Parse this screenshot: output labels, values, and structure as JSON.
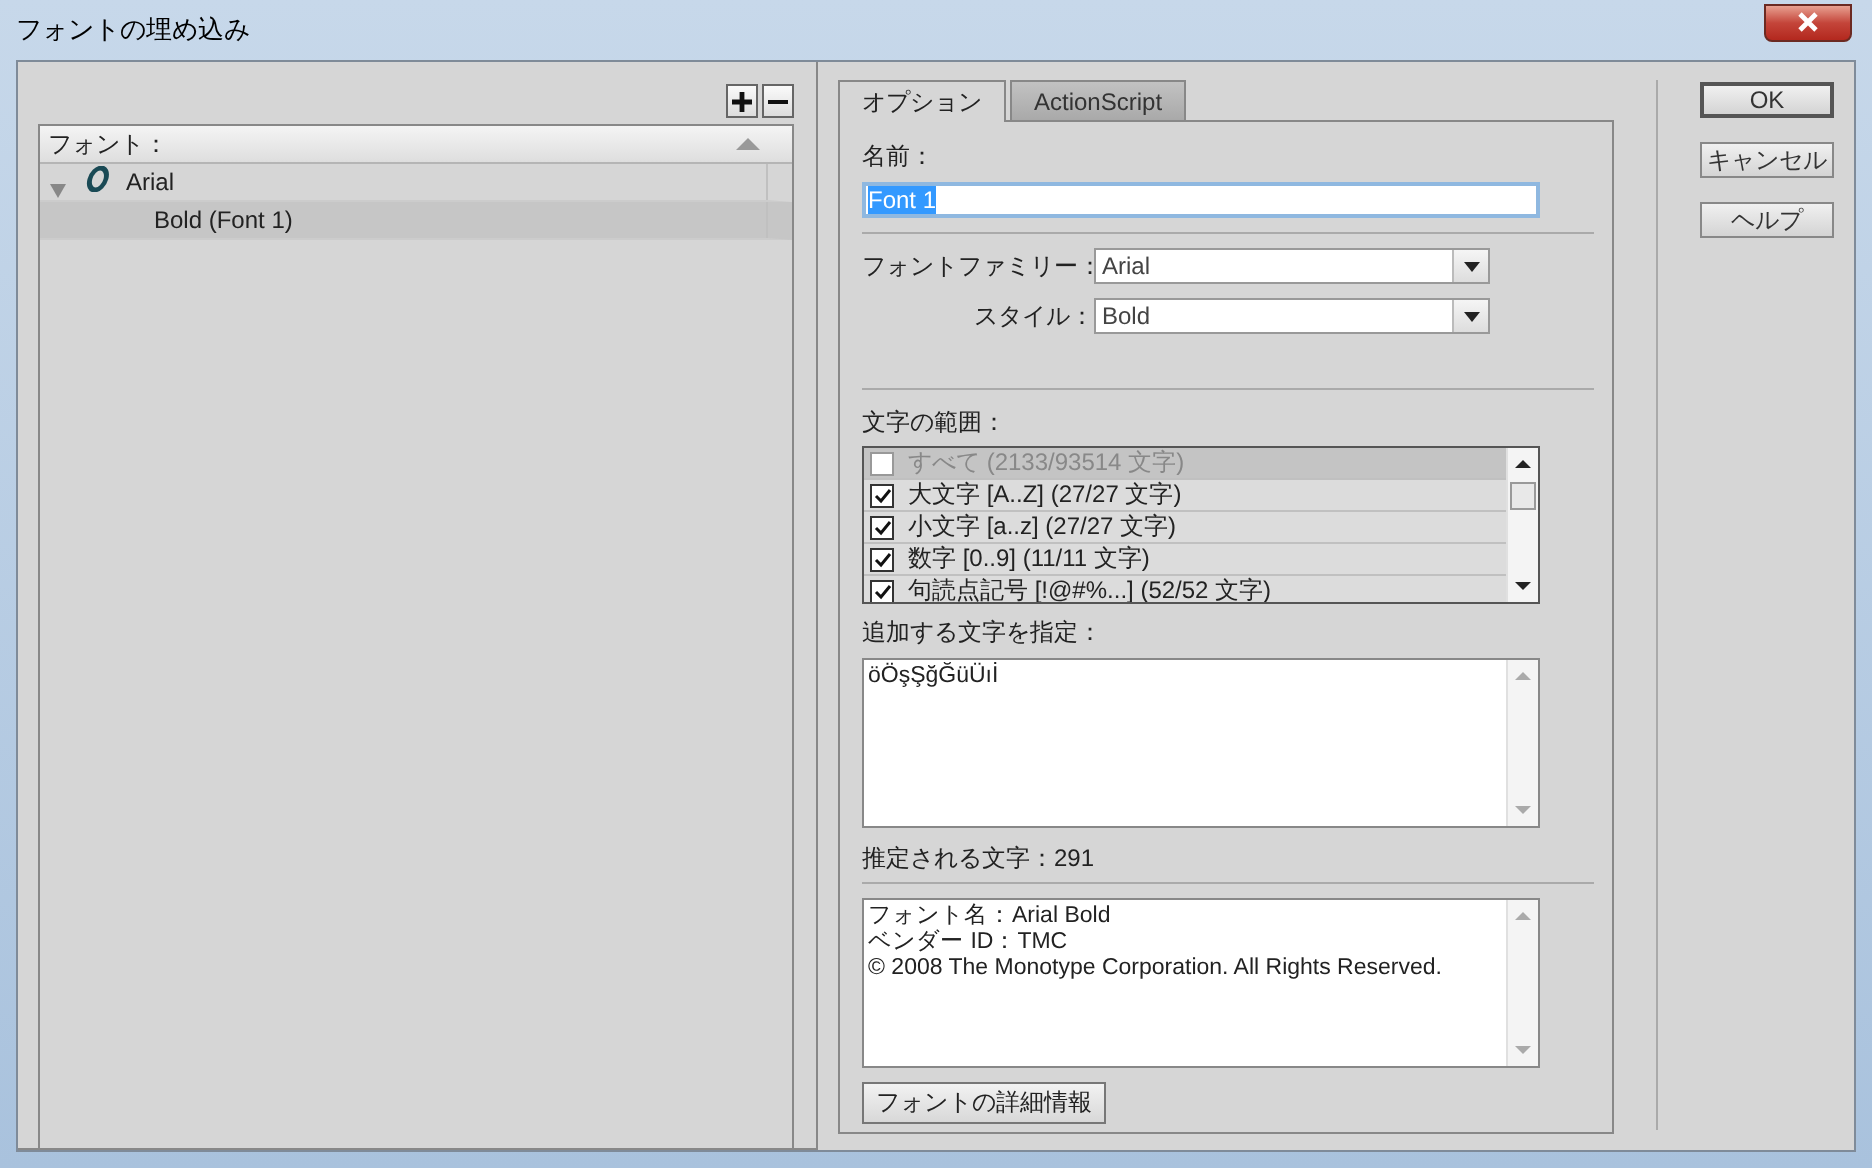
{
  "window": {
    "title": "フォントの埋め込み"
  },
  "font_list": {
    "header": "フォント：",
    "items": [
      {
        "label": "Arial",
        "expanded": true,
        "selected": false,
        "children": [
          {
            "label": "Bold (Font 1)",
            "selected": true
          }
        ]
      }
    ]
  },
  "tabs": [
    {
      "label": "オプション",
      "selected": true
    },
    {
      "label": "ActionScript",
      "selected": false
    }
  ],
  "name_field": {
    "label": "名前：",
    "value": "Font 1",
    "text_selected": true
  },
  "family": {
    "label": "フォントファミリー：",
    "value": "Arial"
  },
  "style": {
    "label": "スタイル：",
    "value": "Bold"
  },
  "ranges": {
    "label": "文字の範囲：",
    "items": [
      {
        "label": "すべて (2133/93514 文字)",
        "checked": false,
        "disabled": true,
        "selected": true
      },
      {
        "label": "大文字 [A..Z] (27/27 文字)",
        "checked": true,
        "disabled": false,
        "selected": false
      },
      {
        "label": "小文字 [a..z] (27/27 文字)",
        "checked": true,
        "disabled": false,
        "selected": false
      },
      {
        "label": "数字 [0..9] (11/11 文字)",
        "checked": true,
        "disabled": false,
        "selected": false
      },
      {
        "label": "句読点記号 [!@#%...] (52/52 文字)",
        "checked": true,
        "disabled": false,
        "selected": false
      }
    ]
  },
  "extra_chars": {
    "label": "追加する文字を指定：",
    "value": "öÖşŞğĞüÜıİ"
  },
  "estimate": "推定される文字：291",
  "info": {
    "lines": [
      "フォント名：Arial Bold",
      "ベンダー ID：TMC",
      "© 2008 The Monotype Corporation. All Rights Reserved."
    ]
  },
  "details_button": "フォントの詳細情報",
  "buttons": [
    {
      "label": "OK",
      "default": true
    },
    {
      "label": "キャンセル",
      "default": false
    },
    {
      "label": "ヘルプ",
      "default": false
    }
  ]
}
